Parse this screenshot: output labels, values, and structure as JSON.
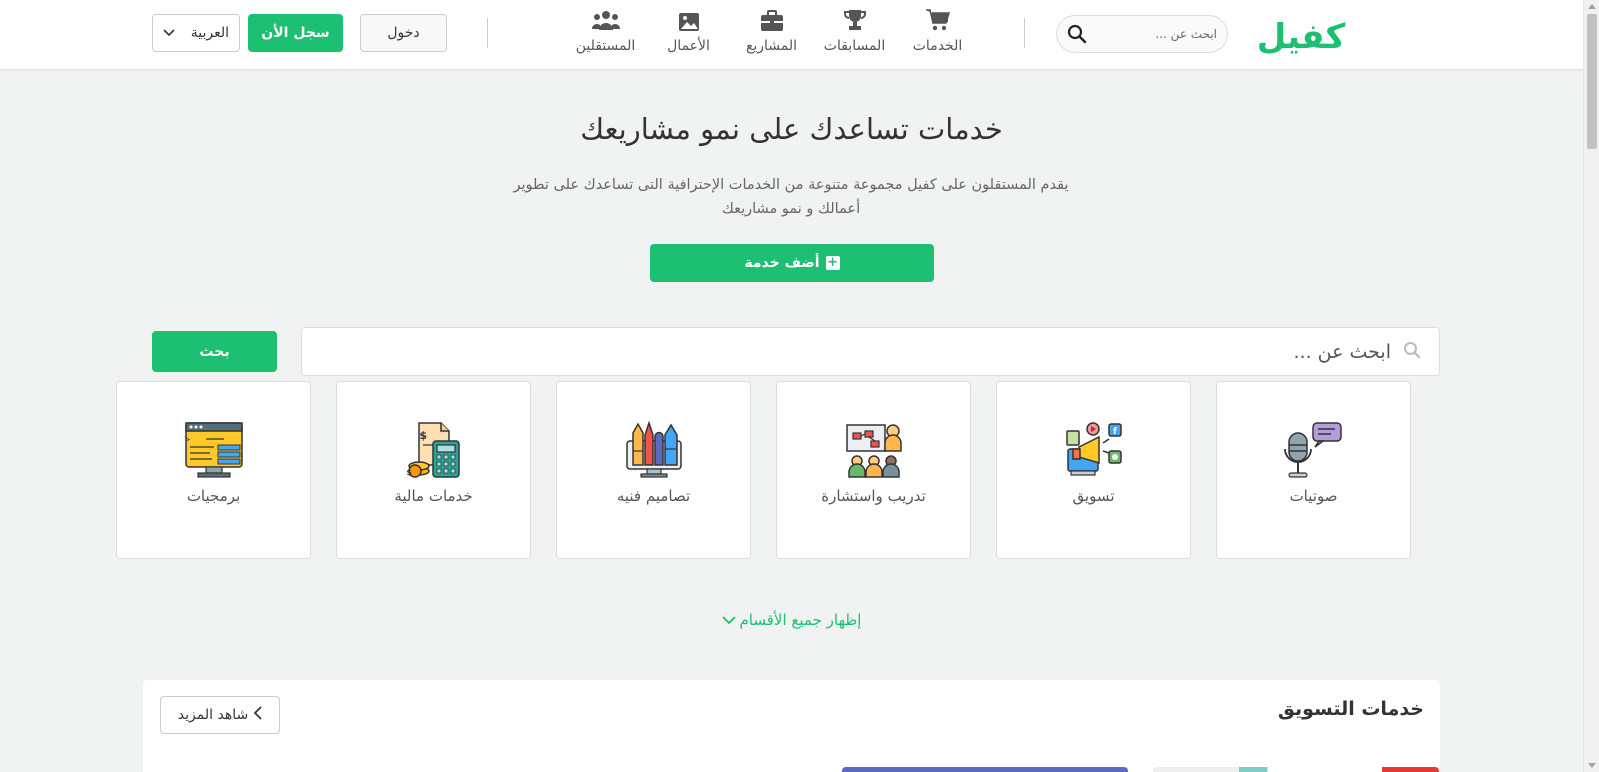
{
  "header": {
    "logo_text": "كفيل",
    "search_placeholder": "ابحث عن ...",
    "nav": [
      {
        "label": "الخدمات",
        "icon": "cart-icon"
      },
      {
        "label": "المسابقات",
        "icon": "trophy-icon"
      },
      {
        "label": "المشاريع",
        "icon": "briefcase-icon"
      },
      {
        "label": "الأعمال",
        "icon": "image-icon"
      },
      {
        "label": "المستقلين",
        "icon": "users-icon"
      }
    ],
    "login_label": "دخول",
    "signup_label": "سجل الأن",
    "language": "العربية"
  },
  "hero": {
    "title": "خدمات تساعدك على نمو مشاريعك",
    "subtitle": "يقدم المستقلون على كفيل مجموعة متنوعة من الخدمات الإحترافية التى تساعدك على تطوير أعمالك و نمو مشاريعك",
    "add_service_label": "أضف خدمة"
  },
  "search": {
    "placeholder": "ابحث عن ...",
    "button_label": "بحث"
  },
  "categories": [
    {
      "label": "صوتيات",
      "icon": "microphone-icon"
    },
    {
      "label": "تسويق",
      "icon": "megaphone-icon"
    },
    {
      "label": "تدريب واستشارة",
      "icon": "presentation-icon"
    },
    {
      "label": "تصاميم فنيه",
      "icon": "art-tools-icon"
    },
    {
      "label": "خدمات مالية",
      "icon": "calculator-icon"
    },
    {
      "label": "برمجيات",
      "icon": "code-monitor-icon"
    }
  ],
  "show_all_label": "إظهار جميع الأقسام",
  "section": {
    "title": "خدمات التسويق",
    "more_label": "شاهد المزيد"
  },
  "colors": {
    "brand": "#1dbf73",
    "background": "#f1f2f2"
  }
}
